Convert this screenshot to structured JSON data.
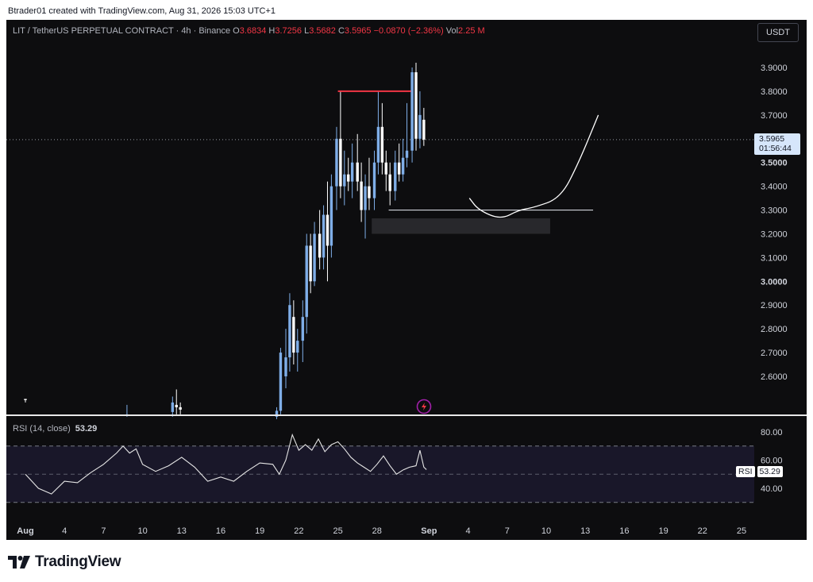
{
  "header": {
    "credit": "Btrader01 created with TradingView.com, Aug 31, 2026 15:03 UTC+1"
  },
  "legend": {
    "symbol": "LIT / TetherUS PERPETUAL CONTRACT · 4h · Binance",
    "o_label": "O",
    "o": "3.6834",
    "h_label": "H",
    "h": "3.7256",
    "l_label": "L",
    "l": "3.5682",
    "c_label": "C",
    "c": "3.5965",
    "change": "−0.0870 (−2.36%)",
    "vol_label": "Vol",
    "vol": "2.25 M"
  },
  "currency_button": "USDT",
  "price_label": {
    "price": "3.5965",
    "countdown": "01:56:44"
  },
  "rsi": {
    "title": "RSI (14, close)",
    "value": "53.29",
    "tag": "RSI"
  },
  "footer": {
    "brand": "TradingView"
  },
  "colors": {
    "background": "#0d0d0f",
    "candle_up": "#7faee8",
    "candle_down": "#ffffff",
    "resistance": "#f23645",
    "rsi_line": "#e6e6e6",
    "rsi_band": "#1c1a2e",
    "price_tag": "#d6e6fb"
  },
  "chart_data": {
    "type": "candlestick",
    "price_axis": {
      "ticks": [
        "3.9000",
        "3.8000",
        "3.7000",
        "3.5000",
        "3.4000",
        "3.3000",
        "3.2000",
        "3.1000",
        "3.0000",
        "2.9000",
        "2.8000",
        "2.7000",
        "2.6000"
      ],
      "bold_ticks": [
        "3.5000",
        "3.0000"
      ],
      "range": [
        2.42,
        4.05
      ]
    },
    "time_axis": {
      "labels": [
        "Aug",
        "4",
        "7",
        "10",
        "13",
        "16",
        "19",
        "22",
        "25",
        "28",
        "Sep",
        "4",
        "7",
        "10",
        "13",
        "16",
        "19",
        "22",
        "25"
      ],
      "start": "Aug 1",
      "unit": "day"
    },
    "candles": [
      {
        "d": 0.0,
        "o": 2.505,
        "h": 2.5,
        "l": 2.49,
        "c": 2.5
      },
      {
        "d": 7.8,
        "o": 2.435,
        "h": 2.48,
        "l": 2.43,
        "c": 2.44
      },
      {
        "d": 11.3,
        "o": 2.45,
        "h": 2.515,
        "l": 2.43,
        "c": 2.49
      },
      {
        "d": 11.6,
        "o": 2.48,
        "h": 2.545,
        "l": 2.44,
        "c": 2.47
      },
      {
        "d": 11.9,
        "o": 2.47,
        "h": 2.49,
        "l": 2.44,
        "c": 2.46
      },
      {
        "d": 19.3,
        "o": 2.43,
        "h": 2.47,
        "l": 2.42,
        "c": 2.455
      },
      {
        "d": 19.6,
        "o": 2.455,
        "h": 2.72,
        "l": 2.44,
        "c": 2.7
      },
      {
        "d": 20.0,
        "o": 2.6,
        "h": 2.8,
        "l": 2.55,
        "c": 2.68
      },
      {
        "d": 20.3,
        "o": 2.68,
        "h": 2.95,
        "l": 2.62,
        "c": 2.9
      },
      {
        "d": 20.6,
        "o": 2.85,
        "h": 2.92,
        "l": 2.65,
        "c": 2.7
      },
      {
        "d": 20.9,
        "o": 2.7,
        "h": 2.8,
        "l": 2.62,
        "c": 2.75
      },
      {
        "d": 21.3,
        "o": 2.75,
        "h": 2.92,
        "l": 2.66,
        "c": 2.85
      },
      {
        "d": 21.6,
        "o": 2.85,
        "h": 3.2,
        "l": 2.78,
        "c": 3.15
      },
      {
        "d": 21.9,
        "o": 3.15,
        "h": 3.2,
        "l": 2.95,
        "c": 3.0
      },
      {
        "d": 22.2,
        "o": 3.0,
        "h": 3.25,
        "l": 2.98,
        "c": 3.2
      },
      {
        "d": 22.6,
        "o": 3.2,
        "h": 3.3,
        "l": 3.05,
        "c": 3.1
      },
      {
        "d": 22.9,
        "o": 3.1,
        "h": 3.32,
        "l": 3.05,
        "c": 3.28
      },
      {
        "d": 23.2,
        "o": 3.28,
        "h": 3.42,
        "l": 3.0,
        "c": 3.15
      },
      {
        "d": 23.5,
        "o": 3.15,
        "h": 3.45,
        "l": 3.1,
        "c": 3.4
      },
      {
        "d": 23.9,
        "o": 3.4,
        "h": 3.65,
        "l": 3.3,
        "c": 3.6
      },
      {
        "d": 24.2,
        "o": 3.6,
        "h": 3.8,
        "l": 3.35,
        "c": 3.4
      },
      {
        "d": 24.5,
        "o": 3.4,
        "h": 3.55,
        "l": 3.32,
        "c": 3.45
      },
      {
        "d": 24.8,
        "o": 3.45,
        "h": 3.52,
        "l": 3.38,
        "c": 3.42
      },
      {
        "d": 25.1,
        "o": 3.42,
        "h": 3.58,
        "l": 3.35,
        "c": 3.5
      },
      {
        "d": 25.5,
        "o": 3.5,
        "h": 3.62,
        "l": 3.38,
        "c": 3.42
      },
      {
        "d": 25.8,
        "o": 3.42,
        "h": 3.5,
        "l": 3.25,
        "c": 3.3
      },
      {
        "d": 26.1,
        "o": 3.3,
        "h": 3.45,
        "l": 3.18,
        "c": 3.4
      },
      {
        "d": 26.4,
        "o": 3.4,
        "h": 3.52,
        "l": 3.3,
        "c": 3.35
      },
      {
        "d": 26.8,
        "o": 3.35,
        "h": 3.55,
        "l": 3.3,
        "c": 3.5
      },
      {
        "d": 27.1,
        "o": 3.5,
        "h": 3.8,
        "l": 3.45,
        "c": 3.65
      },
      {
        "d": 27.4,
        "o": 3.65,
        "h": 3.75,
        "l": 3.45,
        "c": 3.5
      },
      {
        "d": 27.7,
        "o": 3.5,
        "h": 3.55,
        "l": 3.38,
        "c": 3.45
      },
      {
        "d": 28.0,
        "o": 3.45,
        "h": 3.5,
        "l": 3.32,
        "c": 3.38
      },
      {
        "d": 28.4,
        "o": 3.38,
        "h": 3.55,
        "l": 3.34,
        "c": 3.5
      },
      {
        "d": 28.7,
        "o": 3.5,
        "h": 3.58,
        "l": 3.42,
        "c": 3.45
      },
      {
        "d": 29.0,
        "o": 3.45,
        "h": 3.6,
        "l": 3.42,
        "c": 3.52
      },
      {
        "d": 29.3,
        "o": 3.52,
        "h": 3.75,
        "l": 3.48,
        "c": 3.55
      },
      {
        "d": 29.7,
        "o": 3.55,
        "h": 3.9,
        "l": 3.5,
        "c": 3.88
      },
      {
        "d": 30.0,
        "o": 3.88,
        "h": 3.92,
        "l": 3.55,
        "c": 3.6
      },
      {
        "d": 30.3,
        "o": 3.6,
        "h": 3.8,
        "l": 3.56,
        "c": 3.7
      },
      {
        "d": 30.6,
        "o": 3.68,
        "h": 3.73,
        "l": 3.57,
        "c": 3.5965
      }
    ],
    "levels": [
      {
        "name": "resistance",
        "price": 3.8,
        "from_day": 24.0,
        "to_day": 29.6
      },
      {
        "name": "support",
        "price": 3.3,
        "from_day": 27.9,
        "to_day": 43.6
      }
    ],
    "zone": {
      "from_day": 26.6,
      "to_day": 40.3,
      "price_top": 3.265,
      "price_bottom": 3.2
    },
    "drawing_path": [
      [
        34.1,
        3.35
      ],
      [
        34.8,
        3.3
      ],
      [
        36.5,
        3.26
      ],
      [
        37.9,
        3.3
      ],
      [
        39.0,
        3.31
      ],
      [
        41.1,
        3.35
      ],
      [
        42.5,
        3.5
      ],
      [
        44.0,
        3.7
      ]
    ],
    "rsi": {
      "ticks": [
        "80.00",
        "60.00",
        "40.00"
      ],
      "range": [
        32,
        85
      ],
      "bands": [
        70,
        30
      ],
      "values": [
        {
          "d": 0.0,
          "v": 50
        },
        {
          "d": 1.0,
          "v": 40
        },
        {
          "d": 2.0,
          "v": 36
        },
        {
          "d": 3.0,
          "v": 45
        },
        {
          "d": 4.0,
          "v": 44
        },
        {
          "d": 5.0,
          "v": 51
        },
        {
          "d": 6.0,
          "v": 57
        },
        {
          "d": 7.0,
          "v": 65
        },
        {
          "d": 7.5,
          "v": 70
        },
        {
          "d": 8.0,
          "v": 65
        },
        {
          "d": 8.5,
          "v": 68
        },
        {
          "d": 9.0,
          "v": 57
        },
        {
          "d": 10.0,
          "v": 52
        },
        {
          "d": 11.0,
          "v": 56
        },
        {
          "d": 12.0,
          "v": 62
        },
        {
          "d": 13.0,
          "v": 55
        },
        {
          "d": 14.0,
          "v": 45
        },
        {
          "d": 15.0,
          "v": 48
        },
        {
          "d": 16.0,
          "v": 45
        },
        {
          "d": 17.0,
          "v": 52
        },
        {
          "d": 18.0,
          "v": 58
        },
        {
          "d": 19.0,
          "v": 57
        },
        {
          "d": 19.5,
          "v": 50
        },
        {
          "d": 20.0,
          "v": 60
        },
        {
          "d": 20.5,
          "v": 78
        },
        {
          "d": 21.0,
          "v": 67
        },
        {
          "d": 21.5,
          "v": 71
        },
        {
          "d": 22.0,
          "v": 67
        },
        {
          "d": 22.5,
          "v": 75
        },
        {
          "d": 23.0,
          "v": 66
        },
        {
          "d": 23.5,
          "v": 71
        },
        {
          "d": 24.0,
          "v": 73
        },
        {
          "d": 24.5,
          "v": 68
        },
        {
          "d": 25.0,
          "v": 62
        },
        {
          "d": 25.5,
          "v": 58
        },
        {
          "d": 26.0,
          "v": 55
        },
        {
          "d": 26.5,
          "v": 52
        },
        {
          "d": 27.0,
          "v": 57
        },
        {
          "d": 27.5,
          "v": 63
        },
        {
          "d": 28.0,
          "v": 56
        },
        {
          "d": 28.5,
          "v": 50
        },
        {
          "d": 29.0,
          "v": 53
        },
        {
          "d": 29.5,
          "v": 55
        },
        {
          "d": 30.0,
          "v": 56
        },
        {
          "d": 30.3,
          "v": 67
        },
        {
          "d": 30.6,
          "v": 55
        },
        {
          "d": 30.8,
          "v": 53.29
        }
      ]
    }
  }
}
